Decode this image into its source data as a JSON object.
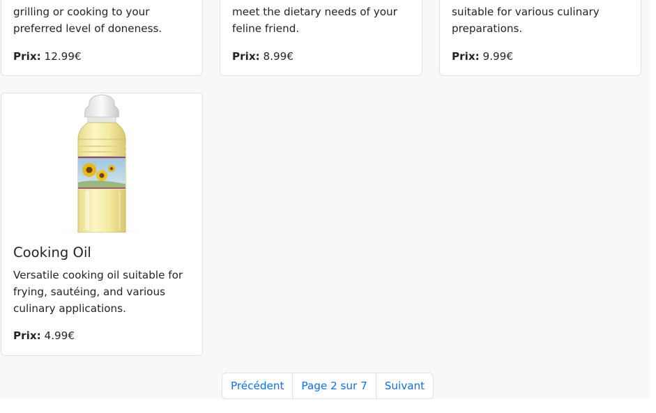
{
  "products": [
    {
      "description_tail": "grilling or cooking to your preferred level of doneness.",
      "price_label": "Prix:",
      "price": "12.99€"
    },
    {
      "description_tail": "meet the dietary needs of your feline friend.",
      "price_label": "Prix:",
      "price": "8.99€"
    },
    {
      "description_tail": "suitable for various culinary preparations.",
      "price_label": "Prix:",
      "price": "9.99€"
    },
    {
      "title": "Cooking Oil",
      "description": "Versatile cooking oil suitable for frying, sautéing, and various culinary applications.",
      "price_label": "Prix:",
      "price": "4.99€",
      "image_icon": "oil-bottle-icon"
    }
  ],
  "pagination": {
    "prev_label": "Précédent",
    "current_label": "Page 2 sur 7",
    "next_label": "Suivant"
  },
  "colors": {
    "link": "#0d6efd",
    "border": "#dee2e6",
    "background": "#f7f8f9"
  }
}
